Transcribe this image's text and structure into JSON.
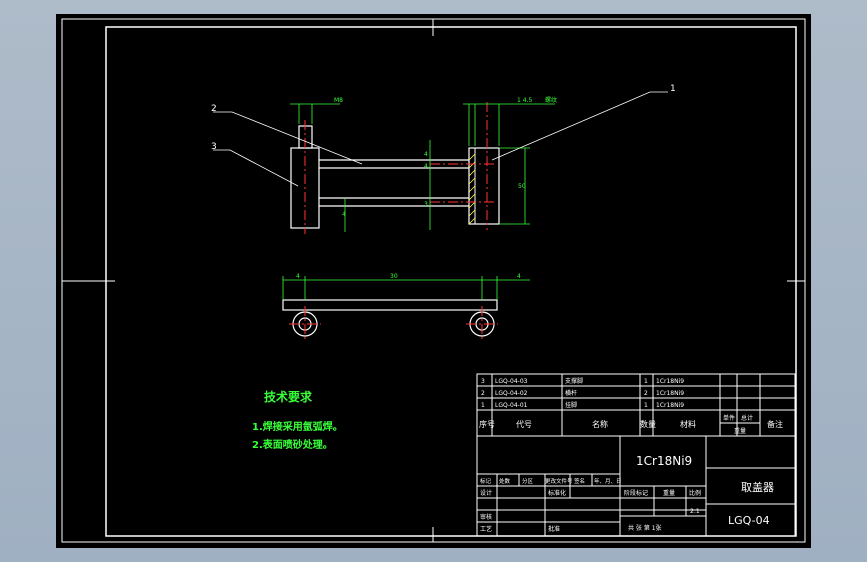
{
  "drawing": {
    "part_labels": [
      "1",
      "2",
      "3"
    ],
    "dims": {
      "top_small": "M8",
      "top_right": "1 4.5",
      "top_right_b": "螺纹",
      "height_right": "50",
      "mid_a": "4",
      "mid_b": "4",
      "mid_c": "3",
      "mid_d": "4",
      "bottom_left": "4",
      "bottom_mid": "30",
      "bottom_right": "4"
    },
    "tech": {
      "title": "技术要求",
      "lines": [
        "1.焊接采用氩弧焊。",
        "2.表面喷砂处理。"
      ]
    }
  },
  "title_block": {
    "bom_rows": [
      {
        "no": "3",
        "code": "LGQ-04-03",
        "name": "支撑脚",
        "qty": "1",
        "material": "1Cr18Ni9"
      },
      {
        "no": "2",
        "code": "LGQ-04-02",
        "name": "横杆",
        "qty": "2",
        "material": "1Cr18Ni9"
      },
      {
        "no": "1",
        "code": "LGQ-04-01",
        "name": "挂脚",
        "qty": "1",
        "material": "1Cr18Ni9"
      }
    ],
    "bom_header": {
      "no": "序号",
      "code": "代号",
      "name": "名称",
      "qty": "数量",
      "material": "材料",
      "unit": "单件",
      "total": "总计",
      "weight": "重量",
      "remark": "备注"
    },
    "material": "1Cr18Ni9",
    "part_name": "取盖器",
    "drawing_no": "LGQ-04",
    "rev_row": [
      "标记",
      "处数",
      "分区",
      "更改文件号",
      "签名",
      "年、月、日"
    ],
    "design": "设计",
    "standard": "标准化",
    "stage_labels": [
      "阶段标记",
      "重量",
      "比例"
    ],
    "scale": "2:1",
    "review": "审核",
    "process": "工艺",
    "approve": "批准",
    "sheet": "共  张  第  1张"
  }
}
